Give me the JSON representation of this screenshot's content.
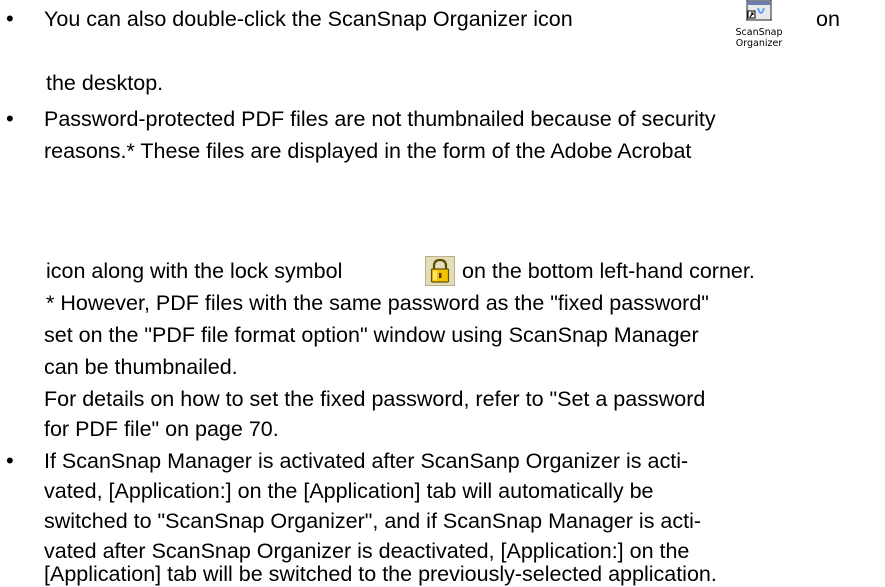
{
  "bullets": [
    {
      "lines": [
        "You can also double-click the ScanSnap Organizer icon",
        "on",
        "the desktop."
      ]
    },
    {
      "lines": [
        "Password-protected PDF files are not thumbnailed because of security",
        "reasons.* These files are displayed in the form of the Adobe Acrobat",
        "icon along with the lock symbol",
        "on the bottom left-hand corner.",
        "* However, PDF files with the same password as the \"fixed password\"",
        "set on the \"PDF file format option\" window using ScanSnap Manager",
        "can be thumbnailed.",
        "For details on how to set the fixed password, refer to \"Set a password",
        "for PDF file\" on page 70."
      ]
    },
    {
      "lines": [
        "If ScanSnap Manager is activated after ScanSanp Organizer is acti-",
        "vated, [Application:] on the [Application] tab will automatically be",
        "switched to \"ScanSnap Organizer\", and if ScanSnap Manager is acti-",
        "vated after ScanSnap Organizer is deactivated, [Application:] on the",
        "[Application] tab will be switched to the previously-selected application."
      ]
    }
  ],
  "bullet_symbol": "•",
  "icon_caption": [
    "ScanSnap",
    "Organizer"
  ],
  "icons": {
    "scansnap": "scansnap-organizer-icon",
    "lock": "lock-icon"
  }
}
